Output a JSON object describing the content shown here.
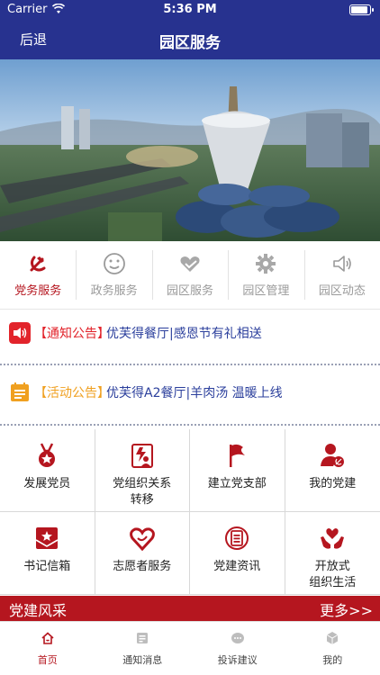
{
  "status_bar": {
    "carrier": "Carrier",
    "time": "5:36 PM",
    "wifi_icon": "wifi-icon",
    "battery_icon": "battery-icon"
  },
  "nav": {
    "back_label": "后退",
    "title": "园区服务"
  },
  "carousel": {
    "dot_count": 3,
    "active_index": 0
  },
  "category_tabs": [
    {
      "label": "党务服务",
      "icon": "party-emblem-icon",
      "active": true
    },
    {
      "label": "政务服务",
      "icon": "smiley-icon",
      "active": false
    },
    {
      "label": "园区服务",
      "icon": "heart-hand-icon",
      "active": false
    },
    {
      "label": "园区管理",
      "icon": "gear-icon",
      "active": false
    },
    {
      "label": "园区动态",
      "icon": "speaker-icon",
      "active": false
    }
  ],
  "notices": [
    {
      "tag": "【通知公告】",
      "text": "优芙得餐厅|感恩节有礼相送",
      "icon": "speaker-icon",
      "color": "#e2242b"
    },
    {
      "tag": "【活动公告】",
      "text": "优芙得A2餐厅|羊肉汤 温暖上线",
      "icon": "list-icon",
      "color": "#f0a020"
    }
  ],
  "services": [
    {
      "label": "发展党员",
      "icon": "medal-icon"
    },
    {
      "label": "党组织关系\n转移",
      "icon": "transfer-icon"
    },
    {
      "label": "建立党支部",
      "icon": "flag-icon"
    },
    {
      "label": "我的党建",
      "icon": "user-emblem-icon"
    },
    {
      "label": "书记信箱",
      "icon": "mailbox-icon"
    },
    {
      "label": "志愿者服务",
      "icon": "heart-icon"
    },
    {
      "label": "党建资讯",
      "icon": "news-icon"
    },
    {
      "label": "开放式\n组织生活",
      "icon": "hands-heart-icon"
    }
  ],
  "section_banner": {
    "title": "党建风采",
    "more": "更多>>"
  },
  "bottom_tabs": [
    {
      "label": "首页",
      "icon": "home-icon",
      "active": true
    },
    {
      "label": "通知消息",
      "icon": "message-icon",
      "active": false
    },
    {
      "label": "投诉建议",
      "icon": "feedback-icon",
      "active": false
    },
    {
      "label": "我的",
      "icon": "profile-icon",
      "active": false
    }
  ],
  "colors": {
    "nav_blue": "#27328f",
    "party_red": "#b5161f",
    "link_blue": "#2b3f9c"
  }
}
